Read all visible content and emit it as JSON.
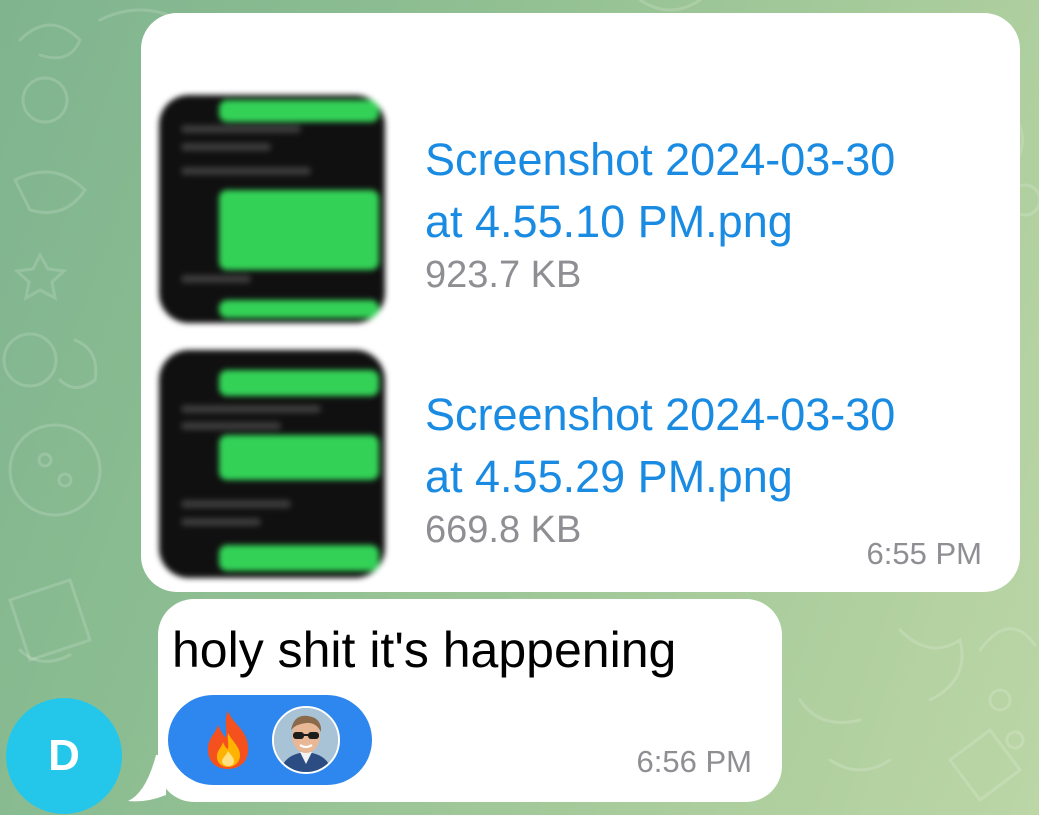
{
  "messages": {
    "files": [
      {
        "name": "Screenshot 2024-03-30\nat 4.55.10 PM.png",
        "size": "923.7 KB"
      },
      {
        "name": "Screenshot 2024-03-30\nat 4.55.29 PM.png",
        "size": "669.8 KB"
      }
    ],
    "files_time": "6:55 PM",
    "text": "holy shit it's happening",
    "text_time": "6:56 PM",
    "reaction": {
      "emoji_icon": "fire-icon",
      "reactor_icon": "user-avatar-photo",
      "pill_color": "#2d87ee"
    }
  },
  "sender": {
    "initial": "D",
    "avatar_color": "#24c7e9"
  },
  "colors": {
    "link": "#1a8be2",
    "meta": "#8e8e93",
    "bubble": "#ffffff"
  }
}
